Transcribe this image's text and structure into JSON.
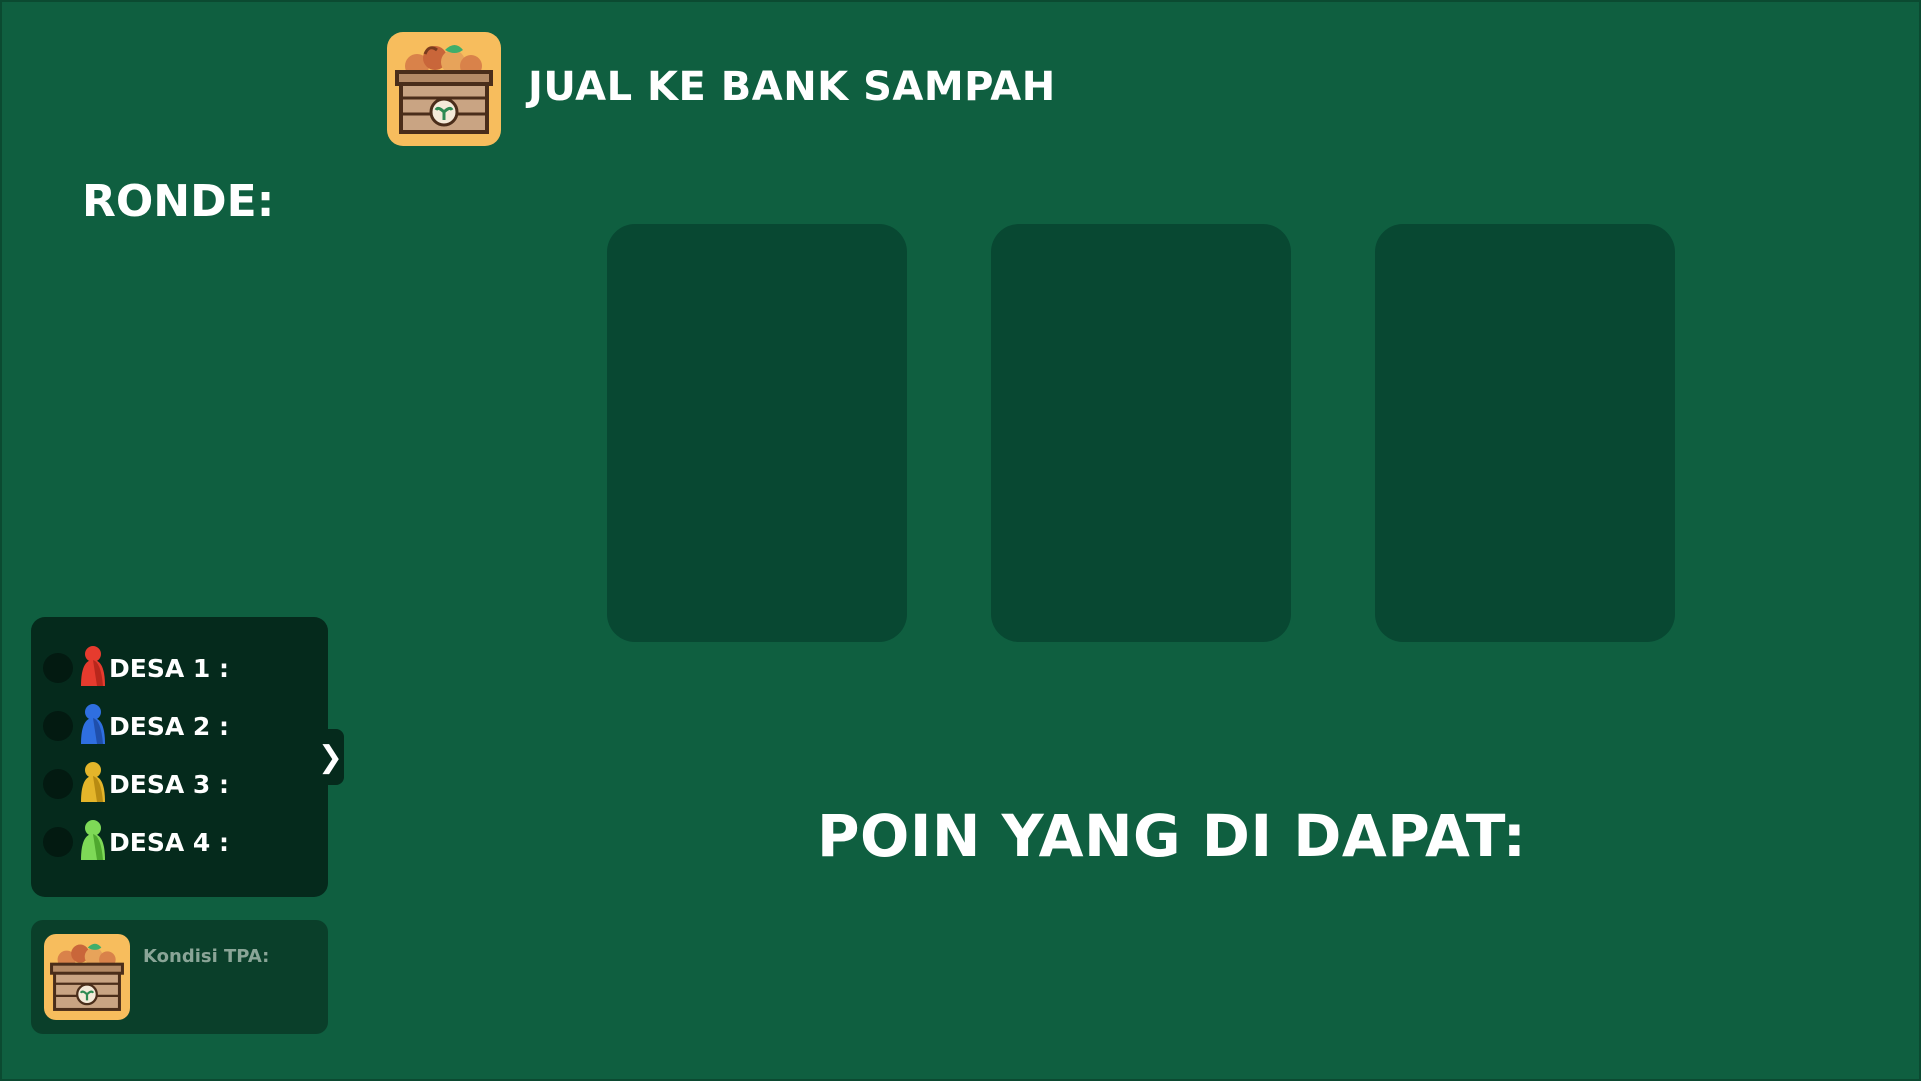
{
  "header": {
    "title": "JUAL KE BANK SAMPAH",
    "icon": "waste-crate-icon"
  },
  "round": {
    "label": "RONDE:"
  },
  "cards": [
    {
      "name": "card-slot-1"
    },
    {
      "name": "card-slot-2"
    },
    {
      "name": "card-slot-3"
    }
  ],
  "points": {
    "label": "POIN YANG DI DAPAT:"
  },
  "players": [
    {
      "label": "DESA 1 :",
      "color": "#e63b2e",
      "icon": "red-pawn-icon"
    },
    {
      "label": "DESA 2 :",
      "color": "#2f6fe0",
      "icon": "blue-pawn-icon"
    },
    {
      "label": "DESA 3 :",
      "color": "#e4b52a",
      "icon": "yellow-pawn-icon"
    },
    {
      "label": "DESA 4 :",
      "color": "#7ed957",
      "icon": "green-pawn-icon"
    }
  ],
  "panel_toggle": {
    "label": "❯"
  },
  "tpa": {
    "label": "Kondisi TPA:",
    "icon": "waste-crate-icon"
  },
  "colors": {
    "background": "#0f5f40",
    "card_slot": "#084832",
    "players_panel": "#052a1c",
    "tpa_panel": "#0a3f2a",
    "icon_bg": "#f7bd5d"
  }
}
